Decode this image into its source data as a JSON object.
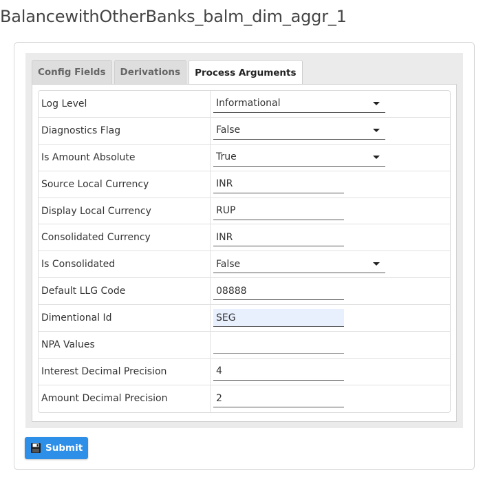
{
  "page": {
    "title": "BalancewithOtherBanks_balm_dim_aggr_1"
  },
  "tabs": [
    {
      "label": "Config Fields",
      "active": false
    },
    {
      "label": "Derivations",
      "active": false
    },
    {
      "label": "Process Arguments",
      "active": true
    }
  ],
  "fields": [
    {
      "label": "Log Level",
      "type": "select",
      "value": "Informational"
    },
    {
      "label": "Diagnostics Flag",
      "type": "select",
      "value": "False"
    },
    {
      "label": "Is Amount Absolute",
      "type": "select",
      "value": "True"
    },
    {
      "label": "Source Local Currency",
      "type": "text",
      "value": "INR"
    },
    {
      "label": "Display Local Currency",
      "type": "text",
      "value": "RUP"
    },
    {
      "label": "Consolidated Currency",
      "type": "text",
      "value": "INR"
    },
    {
      "label": "Is Consolidated",
      "type": "select",
      "value": "False"
    },
    {
      "label": "Default LLG Code",
      "type": "text",
      "value": "08888"
    },
    {
      "label": "Dimentional Id",
      "type": "text",
      "value": "SEG"
    },
    {
      "label": "NPA Values",
      "type": "text",
      "value": ""
    },
    {
      "label": "Interest Decimal Precision",
      "type": "text",
      "value": "4"
    },
    {
      "label": "Amount Decimal Precision",
      "type": "text",
      "value": "2"
    }
  ],
  "actions": {
    "submit_label": "Submit",
    "submit_icon": "save-icon"
  },
  "colors": {
    "accent": "#2d8fe8",
    "focused_input": "#e8f0fe"
  }
}
